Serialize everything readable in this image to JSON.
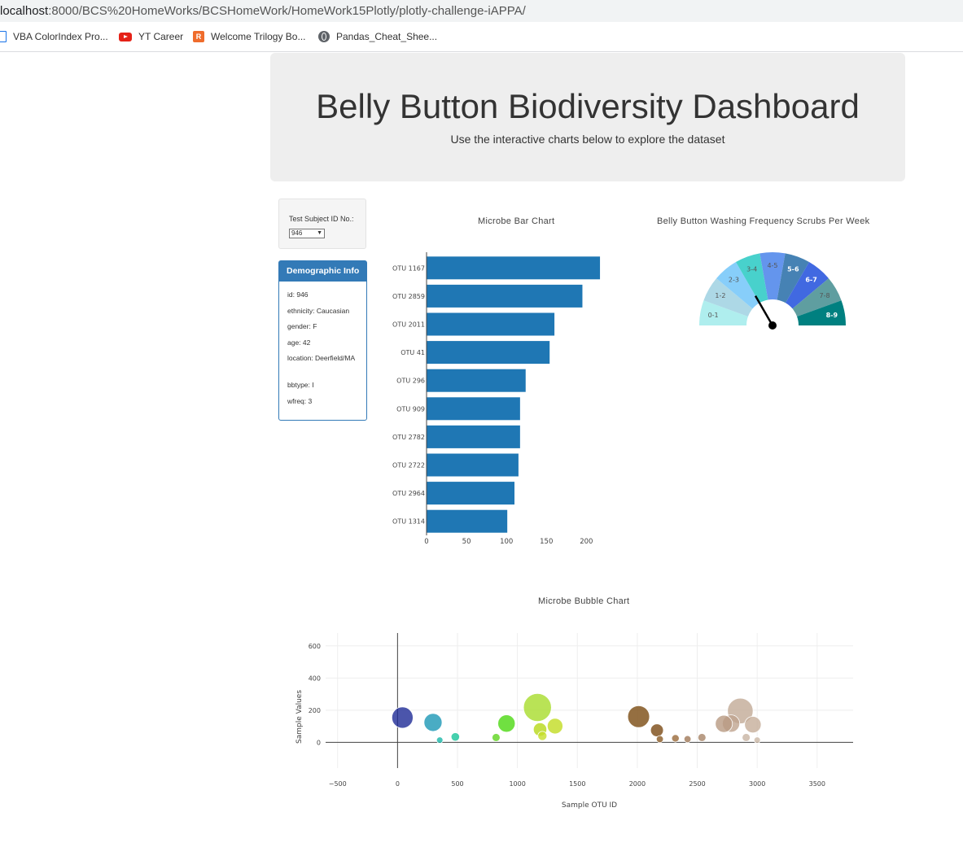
{
  "browser": {
    "url_host": "localhost",
    "url_path": ":8000/BCS%20HomeWorks/BCSHomeWork/HomeWork15Plotly/plotly-challenge-iAPPA/",
    "bookmarks": [
      {
        "label": "VBA ColorIndex Pro...",
        "icon": "document-icon"
      },
      {
        "label": "YT Career",
        "icon": "youtube-icon"
      },
      {
        "label": "Welcome Trilogy Bo...",
        "icon": "trilogy-icon"
      },
      {
        "label": "Pandas_Cheat_Shee...",
        "icon": "globe-icon"
      }
    ]
  },
  "header": {
    "title": "Belly Button Biodiversity Dashboard",
    "subtitle": "Use the interactive charts below to explore the dataset"
  },
  "selector": {
    "label": "Test Subject ID No.:",
    "selected": "946"
  },
  "demographics": {
    "title": "Demographic Info",
    "rows": [
      "id: 946",
      "ethnicity: Caucasian",
      "gender: F",
      "age: 42",
      "location: Deerfield/MA",
      "bbtype: I",
      "wfreq: 3"
    ]
  },
  "chart_data": [
    {
      "type": "bar",
      "orientation": "horizontal",
      "title": "Microbe Bar Chart",
      "categories": [
        "OTU 1167",
        "OTU 2859",
        "OTU 2011",
        "OTU 41",
        "OTU 296",
        "OTU 909",
        "OTU 2782",
        "OTU 2722",
        "OTU 2964",
        "OTU 1314"
      ],
      "values": [
        217,
        195,
        160,
        154,
        124,
        117,
        117,
        115,
        110,
        101
      ],
      "xlim": [
        0,
        220
      ],
      "xticks": [
        0,
        50,
        100,
        150,
        200
      ],
      "color": "#1f77b4"
    },
    {
      "type": "gauge",
      "title": "Belly Button Washing Frequency Scrubs Per Week",
      "segments": [
        "0-1",
        "1-2",
        "2-3",
        "3-4",
        "4-5",
        "5-6",
        "6-7",
        "7-8",
        "8-9"
      ],
      "colors": [
        "#afeeee",
        "#add8e6",
        "#87cefa",
        "#48d1cc",
        "#6495ed",
        "#4682b4",
        "#4169e1",
        "#5f9ea0",
        "#008080"
      ],
      "label_colors": [
        "#555555",
        "#555555",
        "#555555",
        "#555555",
        "#555555",
        "#ffffff",
        "#ffffff",
        "#555555",
        "#ffffff"
      ],
      "value": 3,
      "range": [
        0,
        9
      ]
    },
    {
      "type": "scatter",
      "title": "Microbe Bubble Chart",
      "xlabel": "Sample OTU ID",
      "ylabel": "Sample Values",
      "xlim": [
        -600,
        3800
      ],
      "ylim": [
        -160,
        680
      ],
      "xticks": [
        -500,
        0,
        500,
        1000,
        1500,
        2000,
        2500,
        3000,
        3500
      ],
      "yticks": [
        0,
        200,
        400,
        600
      ],
      "points": [
        {
          "x": 41,
          "y": 154,
          "size": 154,
          "color": "#1e2b96"
        },
        {
          "x": 296,
          "y": 124,
          "size": 124,
          "color": "#1c97b5"
        },
        {
          "x": 482,
          "y": 34,
          "size": 34,
          "color": "#18c49a"
        },
        {
          "x": 352,
          "y": 14,
          "size": 14,
          "color": "#1ab6a8"
        },
        {
          "x": 1167,
          "y": 217,
          "size": 217,
          "color": "#a8dc2c"
        },
        {
          "x": 909,
          "y": 117,
          "size": 117,
          "color": "#4cd812"
        },
        {
          "x": 822,
          "y": 30,
          "size": 30,
          "color": "#5ed41e"
        },
        {
          "x": 1189,
          "y": 80,
          "size": 80,
          "color": "#b6d818"
        },
        {
          "x": 1314,
          "y": 101,
          "size": 101,
          "color": "#c2dc22"
        },
        {
          "x": 1208,
          "y": 40,
          "size": 40,
          "color": "#c6de2a"
        },
        {
          "x": 2011,
          "y": 160,
          "size": 160,
          "color": "#7b4b12"
        },
        {
          "x": 2164,
          "y": 75,
          "size": 75,
          "color": "#7a4a14"
        },
        {
          "x": 2188,
          "y": 20,
          "size": 20,
          "color": "#8a5a24"
        },
        {
          "x": 2318,
          "y": 25,
          "size": 25,
          "color": "#9a6a3a"
        },
        {
          "x": 2419,
          "y": 20,
          "size": 20,
          "color": "#a07858"
        },
        {
          "x": 2539,
          "y": 30,
          "size": 30,
          "color": "#a88468"
        },
        {
          "x": 2859,
          "y": 195,
          "size": 195,
          "color": "#c2aa96"
        },
        {
          "x": 2722,
          "y": 115,
          "size": 115,
          "color": "#b89a82"
        },
        {
          "x": 2782,
          "y": 117,
          "size": 117,
          "color": "#bfa48e"
        },
        {
          "x": 2964,
          "y": 110,
          "size": 110,
          "color": "#c6ae9a"
        },
        {
          "x": 2908,
          "y": 30,
          "size": 30,
          "color": "#c8b4a2"
        },
        {
          "x": 3000,
          "y": 14,
          "size": 14,
          "color": "#cbb8a6"
        }
      ]
    }
  ]
}
